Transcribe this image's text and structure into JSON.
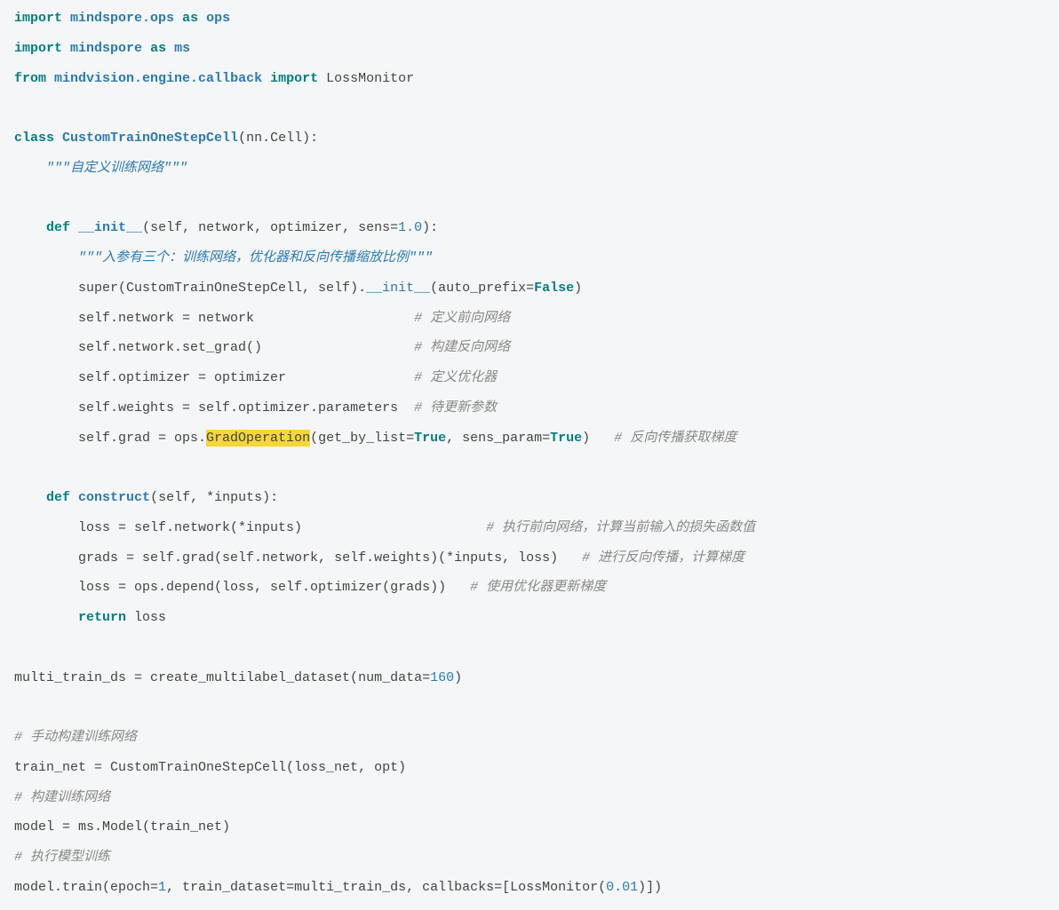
{
  "code": {
    "line1": {
      "kw_import": "import",
      "mod": "mindspore.ops",
      "kw_as": "as",
      "alias": "ops"
    },
    "line2": {
      "kw_import": "import",
      "mod": "mindspore",
      "kw_as": "as",
      "alias": "ms"
    },
    "line3": {
      "kw_from": "from",
      "mod": "mindvision.engine.callback",
      "kw_import": "import",
      "name": "LossMonitor"
    },
    "line5": {
      "kw_class": "class",
      "cls": "CustomTrainOneStepCell",
      "rest": "(nn.Cell):"
    },
    "line6": {
      "doc": "\"\"\"自定义训练网络\"\"\""
    },
    "line8": {
      "kw_def": "def",
      "fn": "__init__",
      "sig_a": "(self, network, optimizer, sens=",
      "num": "1.0",
      "sig_b": "):"
    },
    "line9": {
      "doc": "\"\"\"入参有三个：训练网络，优化器和反向传播缩放比例\"\"\""
    },
    "line10": {
      "txt_a": "super(CustomTrainOneStepCell, self).",
      "dunder": "__init__",
      "txt_b": "(auto_prefix=",
      "val": "False",
      "txt_c": ")"
    },
    "line11": {
      "txt": "self.network = network",
      "com": "# 定义前向网络"
    },
    "line12": {
      "txt": "self.network.set_grad()",
      "com": "# 构建反向网络"
    },
    "line13": {
      "txt": "self.optimizer = optimizer",
      "com": "# 定义优化器"
    },
    "line14": {
      "txt": "self.weights = self.optimizer.parameters",
      "com": "# 待更新参数"
    },
    "line15": {
      "txt_a": "self.grad = ops.",
      "hl": "GradOperation",
      "txt_b": "(get_by_list=",
      "v1": "True",
      "txt_c": ", sens_param=",
      "v2": "True",
      "txt_d": ")",
      "com": "# 反向传播获取梯度"
    },
    "line17": {
      "kw_def": "def",
      "fn": "construct",
      "sig": "(self, *inputs):"
    },
    "line18": {
      "txt": "loss = self.network(*inputs)",
      "com": "# 执行前向网络，计算当前输入的损失函数值"
    },
    "line19": {
      "txt": "grads = self.grad(self.network, self.weights)(*inputs, loss)",
      "com": "# 进行反向传播，计算梯度"
    },
    "line20": {
      "txt": "loss = ops.depend(loss, self.optimizer(grads))",
      "com": "# 使用优化器更新梯度"
    },
    "line21": {
      "kw_return": "return",
      "txt": " loss"
    },
    "line23": {
      "txt_a": "multi_train_ds = create_multilabel_dataset(num_data=",
      "num": "160",
      "txt_b": ")"
    },
    "line25": {
      "com": "# 手动构建训练网络"
    },
    "line26": {
      "txt": "train_net = CustomTrainOneStepCell(loss_net, opt)"
    },
    "line27": {
      "com": "# 构建训练网络"
    },
    "line28": {
      "txt": "model = ms.Model(train_net)"
    },
    "line29": {
      "com": "# 执行模型训练"
    },
    "line30": {
      "txt_a": "model.train(epoch=",
      "n1": "1",
      "txt_b": ", train_dataset=multi_train_ds, callbacks=[LossMonitor(",
      "n2": "0.01",
      "txt_c": ")])"
    }
  }
}
